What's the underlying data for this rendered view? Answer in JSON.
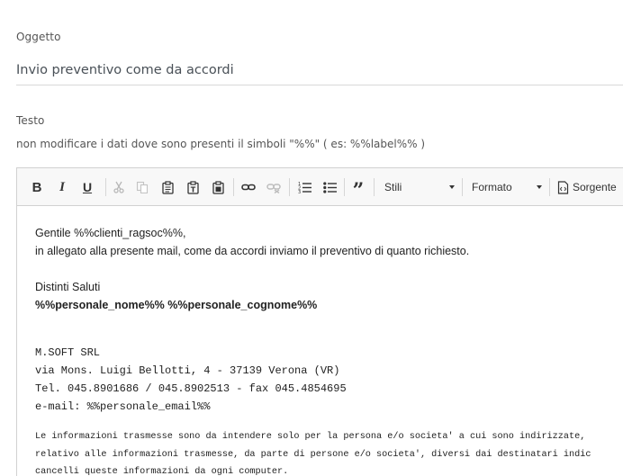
{
  "form": {
    "subject_label": "Oggetto",
    "subject_value": "Invio preventivo come da accordi",
    "text_label": "Testo",
    "hint": "non modificare i dati dove sono presenti il simboli \"%%\" ( es: %%label%% )"
  },
  "toolbar": {
    "styles_label": "Stili",
    "format_label": "Formato",
    "source_label": "Sorgente"
  },
  "body": {
    "greeting": "Gentile %%clienti_ragsoc%%,",
    "line1": "in allegato alla presente mail, come da accordi inviamo il preventivo di quanto richiesto.",
    "closing": "Distinti Saluti",
    "signature": "%%personale_nome%% %%personale_cognome%%",
    "company": "M.SOFT SRL",
    "address": "via Mons. Luigi Bellotti, 4 - 37139 Verona (VR)",
    "phone": "Tel. 045.8901686 / 045.8902513 - fax 045.4854695",
    "email": "e-mail: %%personale_email%%",
    "disclaimer1": "Le informazioni trasmesse sono da intendere solo per la persona e/o societa' a cui sono indirizzate,",
    "disclaimer2": "relativo alle informazioni trasmesse, da parte di persone e/o societa', diversi dai destinatari indic",
    "disclaimer3": "cancelli queste informazioni da ogni computer."
  }
}
